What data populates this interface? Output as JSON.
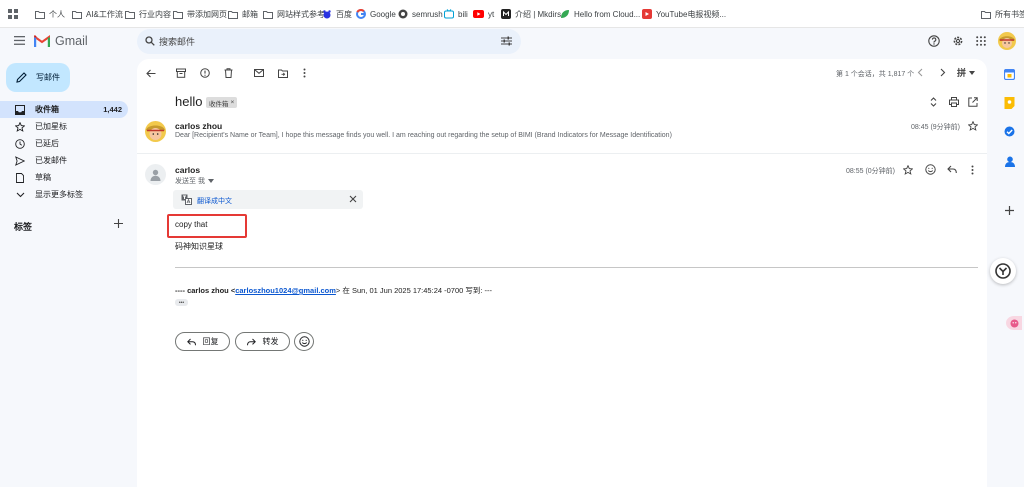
{
  "bookmarks": {
    "items": [
      "个人",
      "AI&工作流",
      "行业内容",
      "带添加网页",
      "邮箱",
      "网站样式参考",
      "百度",
      "Google",
      "semrush",
      "bili",
      "yt",
      "介绍 | Mkdirs",
      "Hello from Cloud...",
      "YouTube电报视频..."
    ],
    "all_label": "所有书签"
  },
  "header": {
    "app_name": "Gmail",
    "search_placeholder": "搜索邮件"
  },
  "nav": {
    "compose_label": "写邮件",
    "items": [
      {
        "label": "收件箱",
        "count": "1,442"
      },
      {
        "label": "已加星标"
      },
      {
        "label": "已延后"
      },
      {
        "label": "已发邮件"
      },
      {
        "label": "草稿"
      },
      {
        "label": "显示更多标签"
      }
    ],
    "labels_title": "标签"
  },
  "toolbar": {
    "pagination": "第 1 个会话，共 1,817 个",
    "input_tool": "拼"
  },
  "thread": {
    "subject": "hello",
    "label_chip": "收件箱",
    "label_chip_close": "×",
    "messages": [
      {
        "sender": "carlos zhou",
        "time": "08:45 (9分钟前)",
        "snippet": "Dear [Recipient's Name or Team], I hope this message finds you well. I am reaching out regarding the setup of BIMI (Brand Indicators for Message Identification)"
      },
      {
        "sender": "carlos",
        "to_line": "发送至 我",
        "time": "08:55 (0分钟前)",
        "translate_label": "翻译成中文",
        "body_lines": [
          "copy that",
          "码神知识星球"
        ],
        "quote_prefix": "---- carlos zhou <",
        "quote_email": "carloszhou1024@gmail.com",
        "quote_suffix": "> 在 Sun, 01 Jun 2025 17:45:24 -0700 写到: ---",
        "ellipsis": "•••"
      }
    ],
    "reply_label": "回复",
    "forward_label": "转发"
  },
  "colors": {
    "highlight_box": "#e53935",
    "compose_bg": "#c2e7ff",
    "active_nav_bg": "#d3e3fd",
    "link": "#0b57d0"
  }
}
